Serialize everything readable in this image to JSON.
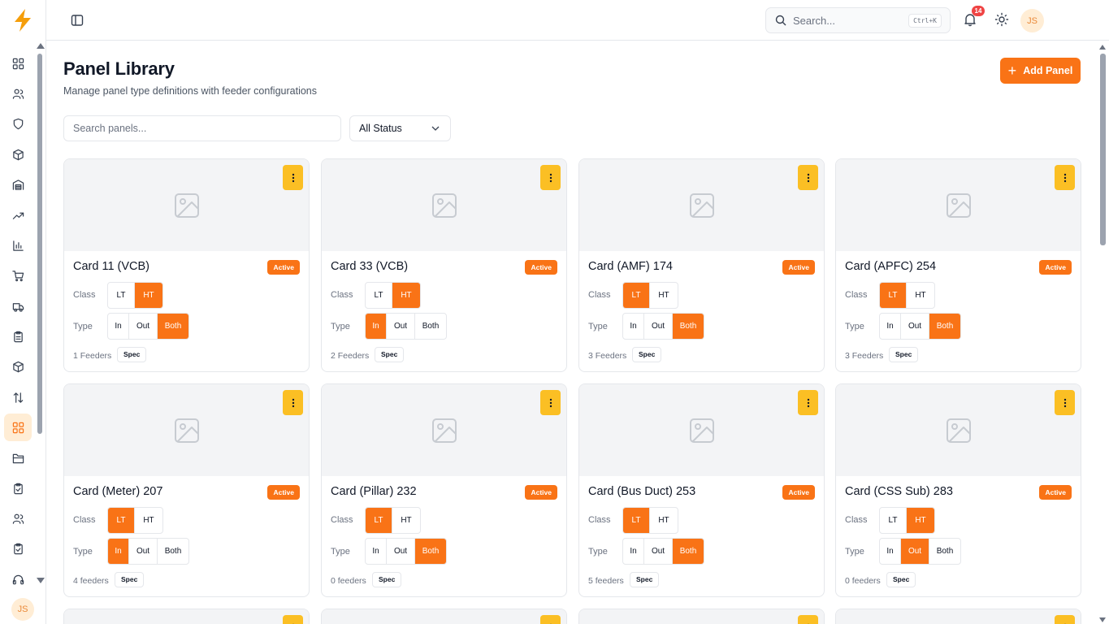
{
  "app": {
    "logo": "lightning-logo"
  },
  "sidebar": {
    "items": [
      {
        "icon": "dashboard-icon"
      },
      {
        "icon": "users-icon"
      },
      {
        "icon": "shield-icon"
      },
      {
        "icon": "box-icon"
      },
      {
        "icon": "warehouse-icon"
      },
      {
        "icon": "trending-up-icon"
      },
      {
        "icon": "bar-chart-icon"
      },
      {
        "icon": "cart-icon"
      },
      {
        "icon": "truck-icon"
      },
      {
        "icon": "clipboard-icon"
      },
      {
        "icon": "package-icon"
      },
      {
        "icon": "transfer-icon"
      },
      {
        "icon": "grid-icon",
        "active": true
      },
      {
        "icon": "folder-icon"
      },
      {
        "icon": "clipboard-check-icon"
      },
      {
        "icon": "team-icon"
      },
      {
        "icon": "clipboard-list-icon"
      },
      {
        "icon": "headset-icon"
      }
    ],
    "avatar": "JS"
  },
  "topbar": {
    "search_placeholder": "Search...",
    "shortcut": "Ctrl+K",
    "notifications": "14",
    "avatar": "JS"
  },
  "page": {
    "title": "Panel Library",
    "subtitle": "Manage panel type definitions with feeder configurations",
    "add_label": "Add Panel",
    "search_placeholder": "Search panels...",
    "status_filter": "All Status"
  },
  "labels": {
    "class": "Class",
    "type": "Type",
    "spec": "Spec"
  },
  "accent": "#f97316",
  "cards": [
    {
      "name": "Card 11 (VCB)",
      "status": "Active",
      "class_on": "HT",
      "type_on": "Both",
      "feeders": "1 Feeders"
    },
    {
      "name": "Card 33 (VCB)",
      "status": "Active",
      "class_on": "HT",
      "type_on": "In",
      "feeders": "2 Feeders"
    },
    {
      "name": "Card (AMF) 174",
      "status": "Active",
      "class_on": "LT",
      "type_on": "Both",
      "feeders": "3 Feeders"
    },
    {
      "name": "Card (APFC) 254",
      "status": "Active",
      "class_on": "LT",
      "type_on": "Both",
      "feeders": "3 Feeders"
    },
    {
      "name": "Card (Meter) 207",
      "status": "Active",
      "class_on": "LT",
      "type_on": "In",
      "feeders": "4 feeders"
    },
    {
      "name": "Card (Pillar) 232",
      "status": "Active",
      "class_on": "LT",
      "type_on": "Both",
      "feeders": "0 feeders"
    },
    {
      "name": "Card (Bus Duct) 253",
      "status": "Active",
      "class_on": "LT",
      "type_on": "Both",
      "feeders": "5 feeders"
    },
    {
      "name": "Card (CSS Sub) 283",
      "status": "Active",
      "class_on": "HT",
      "type_on": "Out",
      "feeders": "0 feeders"
    }
  ],
  "options": {
    "class": [
      "LT",
      "HT"
    ],
    "type": [
      "In",
      "Out",
      "Both"
    ]
  }
}
